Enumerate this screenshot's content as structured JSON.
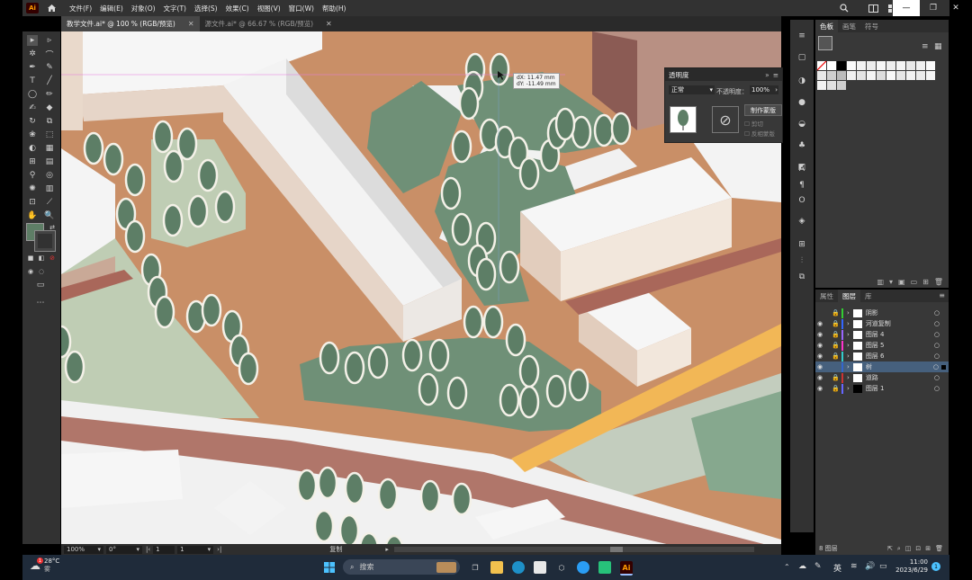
{
  "app": {
    "logo": "Ai",
    "menu": [
      "文件(F)",
      "编辑(E)",
      "对象(O)",
      "文字(T)",
      "选择(S)",
      "效果(C)",
      "视图(V)",
      "窗口(W)",
      "帮助(H)"
    ]
  },
  "tabs": [
    {
      "label": "教学文件.ai* @ 100 % (RGB/预览)",
      "active": true
    },
    {
      "label": "源文件.ai* @ 66.67 % (RGB/预览)",
      "active": false
    }
  ],
  "tooltip": {
    "dx": "dX: 11.47 mm",
    "dy": "dY: -11.49 mm"
  },
  "transparency_panel": {
    "title": "透明度",
    "blend_mode": "正常",
    "opacity_label": "不透明度：",
    "opacity_value": "100%",
    "make_mask": "制作蒙版",
    "clip": "剪切",
    "invert_mask": "反相蒙版"
  },
  "swatches_panel": {
    "tabs": [
      "色板",
      "画笔",
      "符号"
    ],
    "colors": [
      "#ffffff",
      "#d9d9d9",
      "#bfbfbf",
      "#a6a6a6",
      "#8c8c8c",
      "#737373",
      "#595959",
      "#404040",
      "#262626",
      "#000000",
      "#f2f2f2",
      "#e6e6e6"
    ]
  },
  "layers_panel": {
    "tabs": [
      "属性",
      "图层",
      "库"
    ],
    "layers": [
      {
        "name": "阴影",
        "color": "#33cc33",
        "locked": true,
        "selected": false
      },
      {
        "name": "河道复制",
        "color": "#3366ff",
        "locked": true,
        "selected": false
      },
      {
        "name": "图层 4",
        "color": "#9966ff",
        "locked": true,
        "selected": false
      },
      {
        "name": "图层 5",
        "color": "#ff33cc",
        "locked": true,
        "selected": false
      },
      {
        "name": "图层 6",
        "color": "#33cccc",
        "locked": true,
        "selected": false
      },
      {
        "name": "树",
        "color": "#3366cc",
        "locked": false,
        "selected": true
      },
      {
        "name": "道路",
        "color": "#cc3333",
        "locked": true,
        "selected": false
      },
      {
        "name": "图层 1",
        "color": "#6666ff",
        "locked": true,
        "selected": false
      }
    ],
    "footer": "8 图层"
  },
  "statusbar": {
    "zoom": "100%",
    "rotation": "0°",
    "artboard_a": "1",
    "artboard_b": "1",
    "tool": "复制"
  },
  "taskbar": {
    "weather_temp": "28°C",
    "weather_desc": "雾",
    "search_placeholder": "搜索",
    "ime": "英",
    "time": "11:00",
    "date": "2023/6/29",
    "notification_count": "1"
  }
}
